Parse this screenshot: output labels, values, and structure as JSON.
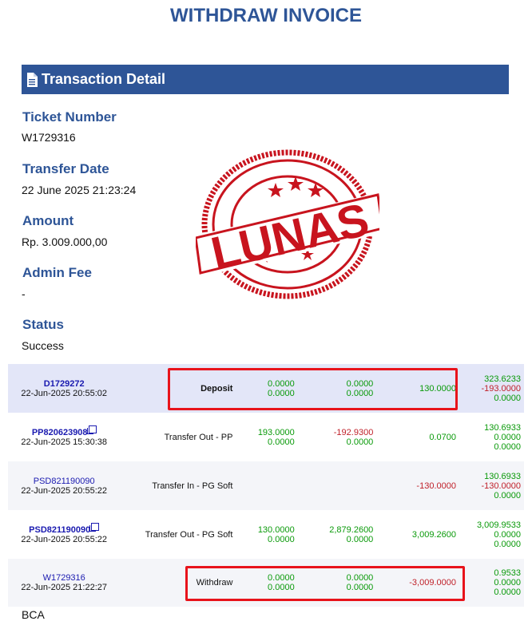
{
  "page_title": "WITHDRAW INVOICE",
  "section_title": "Transaction Detail",
  "colors": {
    "brand": "#2e5597",
    "positive": "#0a9a0a",
    "negative": "#c0212a",
    "highlight": "#e8131b",
    "stamp": "#c8141e"
  },
  "stamp_text": "LUNAS",
  "fields": {
    "ticket_number_label": "Ticket Number",
    "ticket_number_value": "W1729316",
    "transfer_date_label": "Transfer Date",
    "transfer_date_value": "22 June 2025 21:23:24",
    "amount_label": "Amount",
    "amount_value": "Rp. 3.009.000,00",
    "admin_fee_label": "Admin Fee",
    "admin_fee_value": "-",
    "status_label": "Status",
    "status_value": "Success"
  },
  "transactions": [
    {
      "id": "D1729272",
      "date": "22-Jun-2025 20:55:02",
      "type": "Deposit",
      "a1": "0.0000",
      "a2": "0.0000",
      "b1": "0.0000",
      "b2": "0.0000",
      "c": "130.0000",
      "d1": "323.6233",
      "d2": "-193.0000",
      "d3": "0.0000"
    },
    {
      "id": "PP820623908",
      "date": "22-Jun-2025 15:30:38",
      "type": "Transfer Out - PP",
      "a1": "193.0000",
      "a2": "0.0000",
      "b1": "-192.9300",
      "b2": "0.0000",
      "c": "0.0700",
      "d1": "130.6933",
      "d2": "0.0000",
      "d3": "0.0000"
    },
    {
      "id": "PSD821190090",
      "date": "22-Jun-2025 20:55:22",
      "type": "Transfer In - PG Soft",
      "c": "-130.0000",
      "d1": "130.6933",
      "d2": "-130.0000",
      "d3": "0.0000"
    },
    {
      "id": "PSD821190090",
      "date": "22-Jun-2025 20:55:22",
      "type": "Transfer Out - PG Soft",
      "a1": "130.0000",
      "a2": "0.0000",
      "b1": "2,879.2600",
      "b2": "0.0000",
      "c": "3,009.2600",
      "d1": "3,009.9533",
      "d2": "0.0000",
      "d3": "0.0000"
    },
    {
      "id": "W1729316",
      "date": "22-Jun-2025 21:22:27",
      "type": "Withdraw",
      "a1": "0.0000",
      "a2": "0.0000",
      "b1": "0.0000",
      "b2": "0.0000",
      "c": "-3,009.0000",
      "d1": "0.9533",
      "d2": "0.0000",
      "d3": "0.0000"
    }
  ],
  "bank": "BCA"
}
